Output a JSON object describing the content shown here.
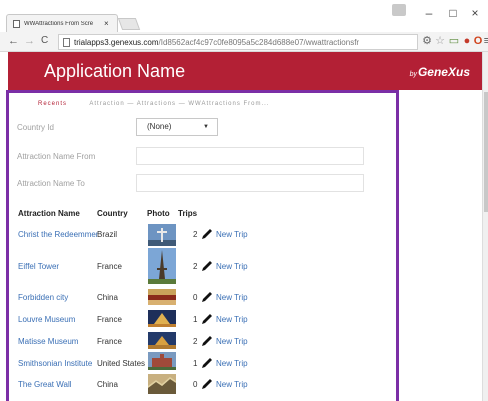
{
  "browser": {
    "tab_title": "WWAttractions From Scre",
    "tab_close": "×",
    "url_host": "trialapps3.genexus.com",
    "url_path": "/Id8562acf4c97c0fe8095a5c284d688e07/wwattractionsfr",
    "back_glyph": "←",
    "forward_glyph": "→",
    "reload_glyph": "C",
    "minimize_glyph": "–",
    "maximize_glyph": "□",
    "close_glyph": "×",
    "menu_glyph": "≡"
  },
  "app": {
    "title": "Application Name",
    "brand_prefix": "by",
    "brand_name": "GeneXus",
    "accent_color": "#b32035",
    "frame_color": "#7b2fa6"
  },
  "breadcrumb": {
    "recents": "Recents",
    "trail": "Attraction — Attractions — WWAttractions From..."
  },
  "filters": {
    "country_label": "Country Id",
    "country_value": "(None)",
    "name_from_label": "Attraction Name From",
    "name_from_value": "",
    "name_to_label": "Attraction Name To",
    "name_to_value": ""
  },
  "table": {
    "headers": {
      "name": "Attraction Name",
      "country": "Country",
      "photo": "Photo",
      "trips": "Trips"
    },
    "new_trip_label": "New Trip",
    "rows": [
      {
        "name": "Christ the Redeemmer",
        "country": "Brazil",
        "trips": "2"
      },
      {
        "name": "Eiffel Tower",
        "country": "France",
        "trips": "2"
      },
      {
        "name": "Forbidden city",
        "country": "China",
        "trips": "0"
      },
      {
        "name": "Louvre Museum",
        "country": "France",
        "trips": "1"
      },
      {
        "name": "Matisse Museum",
        "country": "France",
        "trips": "2"
      },
      {
        "name": "Smithsonian Institute",
        "country": "United States",
        "trips": "1"
      },
      {
        "name": "The Great Wall",
        "country": "China",
        "trips": "0"
      }
    ]
  }
}
